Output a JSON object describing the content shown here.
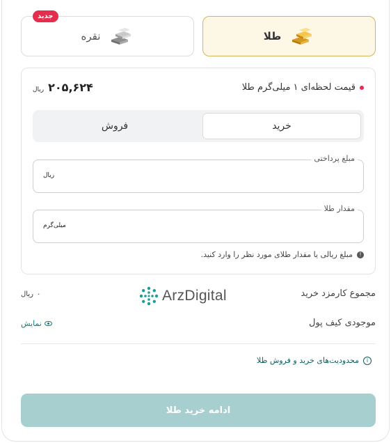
{
  "tabs": {
    "gold": {
      "label": "طلا",
      "icon": "gold-bars-icon"
    },
    "silver": {
      "label": "نقره",
      "badge": "جدید",
      "icon": "silver-bars-icon"
    }
  },
  "price": {
    "label": "قیمت لحظه‌ای ۱ میلی‌گرم طلا",
    "value": "۲۰۵,۶۲۴",
    "unit": "ریال"
  },
  "segment": {
    "buy": "خرید",
    "sell": "فروش",
    "selected": "buy"
  },
  "fields": {
    "payment": {
      "legend": "مبلغ پرداختی",
      "unit": "ریال",
      "value": ""
    },
    "amount": {
      "legend": "مقدار طلا",
      "unit": "میلی‌گرم",
      "value": ""
    }
  },
  "hint": "مبلغ ریالی یا مقدار طلای مورد نظر را وارد کنید.",
  "summary": {
    "fee_label": "مجموع کارمزد خرید",
    "fee_value": "۰",
    "fee_unit": "ریال",
    "wallet_label": "موجودی کیف پول",
    "show_label": "نمایش"
  },
  "logo": {
    "text": "ArzDigital"
  },
  "limits_link": "محدودیت‌های خرید و فروش طلا",
  "cta": "ادامه خرید طلا",
  "colors": {
    "accent": "#0e7b78",
    "cta_disabled": "#a8cfd0",
    "gold_tab_bg": "#fdf7e6",
    "gold_tab_border": "#d7b25a",
    "badge": "#e52d4d"
  }
}
